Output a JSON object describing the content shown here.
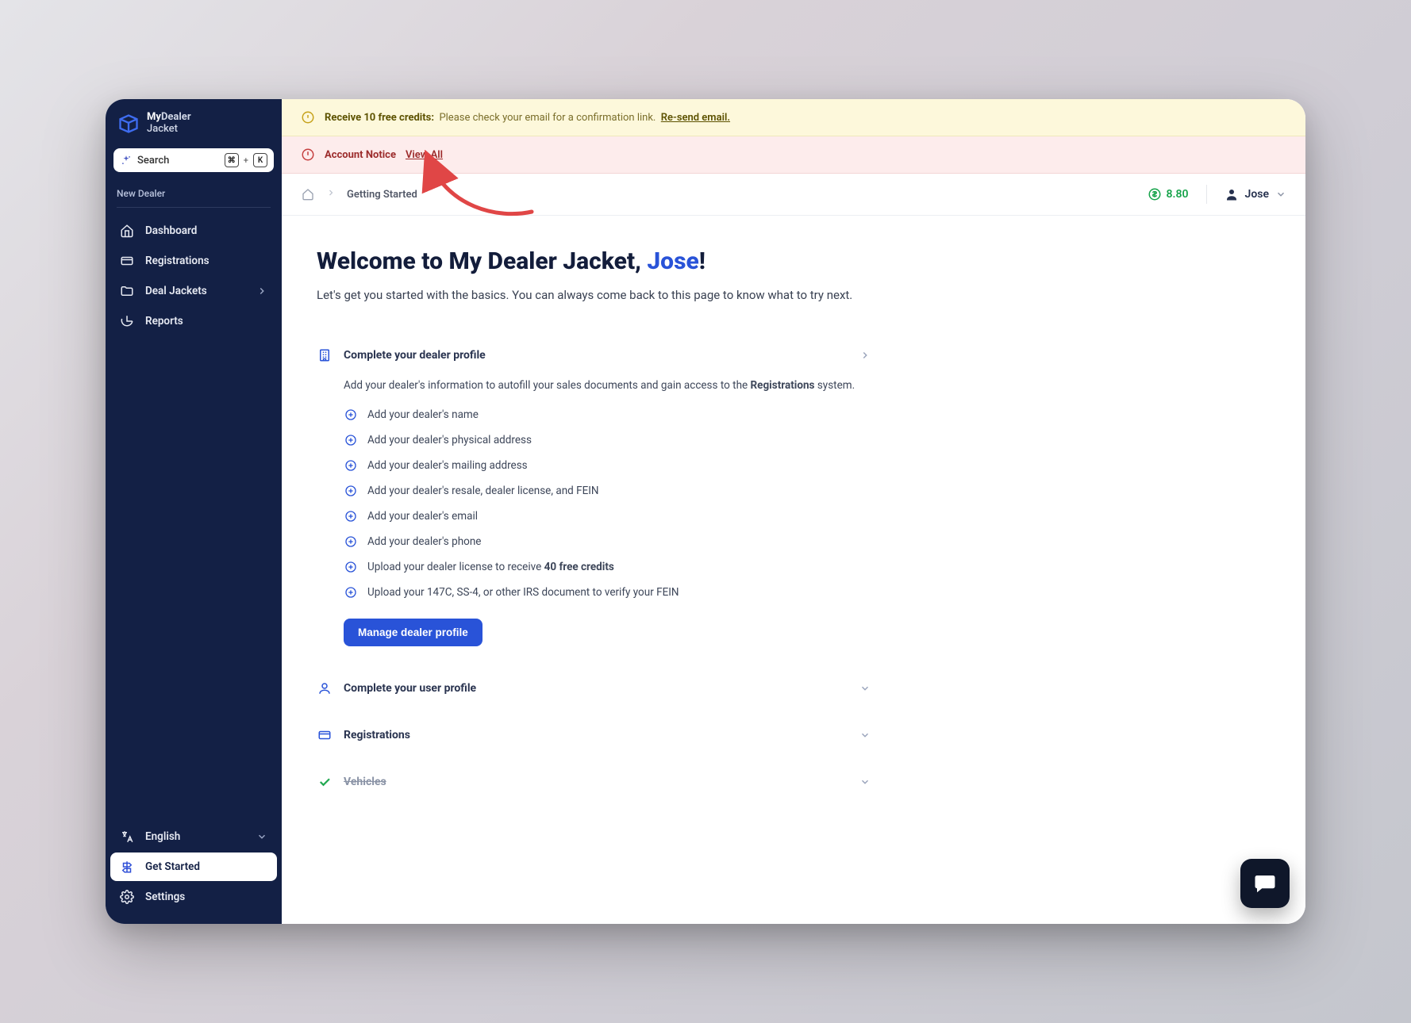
{
  "brand": {
    "line1_prefix": "My",
    "line1_suffix": "Dealer",
    "line2": "Jacket"
  },
  "search": {
    "label": "Search",
    "key1": "⌘",
    "plus": "+",
    "key2": "K"
  },
  "sidebar": {
    "section_label": "New Dealer",
    "items": [
      {
        "label": "Dashboard"
      },
      {
        "label": "Registrations"
      },
      {
        "label": "Deal Jackets",
        "has_children": true
      },
      {
        "label": "Reports"
      }
    ]
  },
  "bottom": {
    "language": "English",
    "get_started": "Get Started",
    "settings": "Settings"
  },
  "banners": {
    "credits": {
      "strong": "Receive 10 free credits:",
      "text": "Please check your email for a confirmation link.",
      "link": "Re-send email."
    },
    "notice": {
      "label": "Account Notice",
      "link": "View All"
    }
  },
  "breadcrumb": {
    "current": "Getting Started"
  },
  "credits_balance": "8.80",
  "user": {
    "name": "Jose"
  },
  "page": {
    "title_prefix": "Welcome to My Dealer Jacket, ",
    "title_suffix": "!",
    "subhead": "Let's get you started with the basics. You can always come back to this page to know what to try next."
  },
  "sections": [
    {
      "key": "dealer",
      "title": "Complete your dealer profile",
      "desc_pre": "Add your dealer's information to autofill your sales documents and gain access to the ",
      "desc_bold": "Registrations",
      "desc_post": " system.",
      "expanded": true,
      "tasks": [
        {
          "text": "Add your dealer's name"
        },
        {
          "text": "Add your dealer's physical address"
        },
        {
          "text": "Add your dealer's mailing address"
        },
        {
          "text": "Add your dealer's resale, dealer license, and FEIN"
        },
        {
          "text": "Add your dealer's email"
        },
        {
          "text": "Add your dealer's phone"
        },
        {
          "text_pre": "Upload your dealer license to receive ",
          "bold": "40 free credits"
        },
        {
          "text": "Upload your 147C, SS-4, or other IRS document to verify your FEIN"
        }
      ],
      "cta": "Manage dealer profile"
    },
    {
      "key": "user",
      "title": "Complete your user profile",
      "expanded": false
    },
    {
      "key": "regs",
      "title": "Registrations",
      "expanded": false
    },
    {
      "key": "vehicles",
      "title": "Vehicles",
      "expanded": false,
      "done": true
    }
  ]
}
